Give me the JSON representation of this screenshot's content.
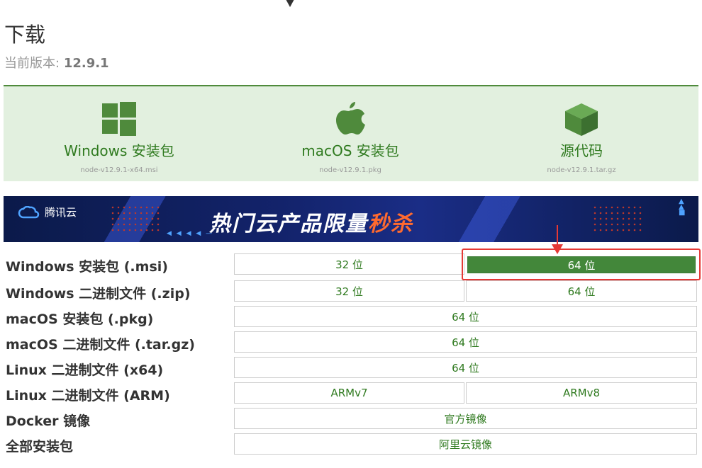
{
  "title": "下载",
  "version_label": "当前版本:",
  "version_value": "12.9.1",
  "downloads": [
    {
      "label": "Windows 安装包",
      "file": "node-v12.9.1-x64.msi",
      "icon": "windows-icon"
    },
    {
      "label": "macOS 安装包",
      "file": "node-v12.9.1.pkg",
      "icon": "apple-icon"
    },
    {
      "label": "源代码",
      "file": "node-v12.9.1.tar.gz",
      "icon": "cube-icon"
    }
  ],
  "banner": {
    "brand": "腾讯云",
    "headline_main": "热门云产品限量",
    "headline_hot": "秒杀"
  },
  "rows": [
    {
      "label": "Windows 安装包 (.msi)",
      "cells": [
        "32 位",
        "64 位"
      ]
    },
    {
      "label": "Windows 二进制文件 (.zip)",
      "cells": [
        "32 位",
        "64 位"
      ]
    },
    {
      "label": "macOS 安装包 (.pkg)",
      "cells": [
        "64 位"
      ]
    },
    {
      "label": "macOS 二进制文件 (.tar.gz)",
      "cells": [
        "64 位"
      ]
    },
    {
      "label": "Linux 二进制文件 (x64)",
      "cells": [
        "64 位"
      ]
    },
    {
      "label": "Linux 二进制文件 (ARM)",
      "cells": [
        "ARMv7",
        "ARMv8"
      ]
    },
    {
      "label": "Docker 镜像",
      "cells": [
        "官方镜像"
      ]
    },
    {
      "label": "全部安装包",
      "cells": [
        "阿里云镜像"
      ]
    }
  ],
  "colors": {
    "accent_green": "#43873a",
    "highlight_red": "#e53935",
    "panel_bg": "#e2f0df"
  }
}
